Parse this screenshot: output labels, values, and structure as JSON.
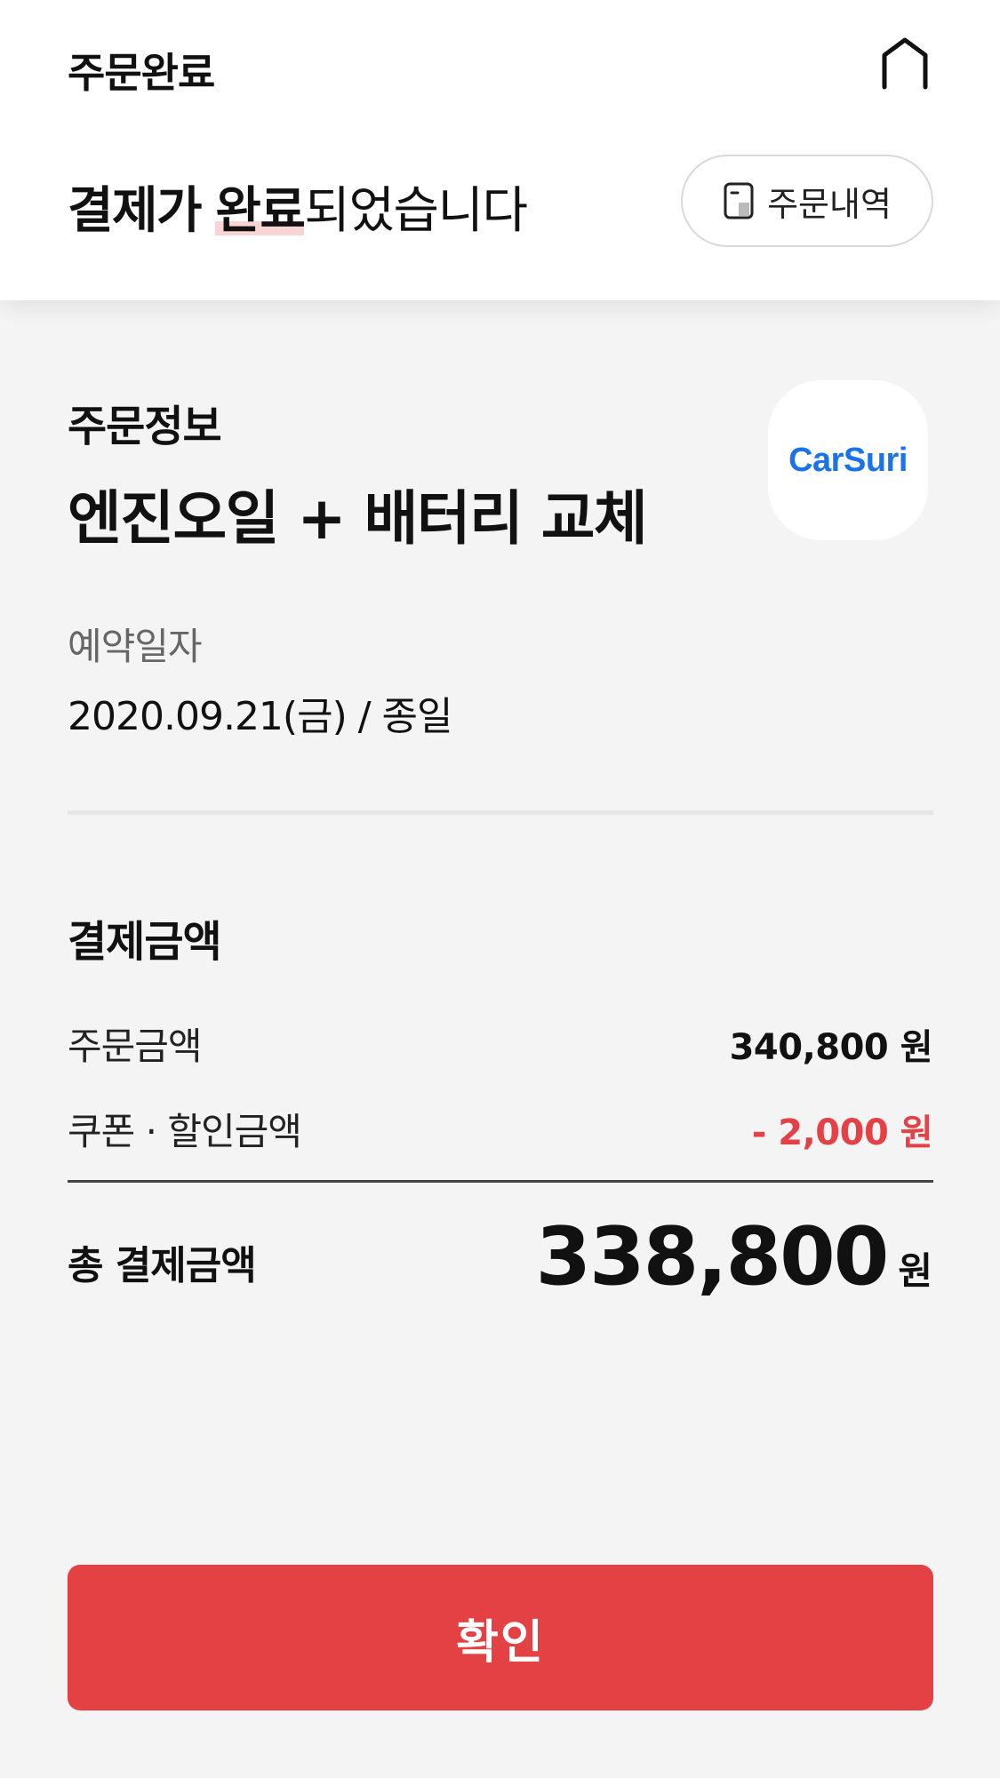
{
  "header": {
    "nav_title": "주문완료",
    "headline_strong": "결제가",
    "headline_highlight": "완료",
    "headline_rest": "되었습니다",
    "history_button_label": "주문내역"
  },
  "order_info": {
    "section_title": "주문정보",
    "product_name": "엔진오일 + 배터리 교체",
    "logo_text": "CarSuri",
    "reservation_label": "예약일자",
    "reservation_value": "2020.09.21(금) / 종일"
  },
  "payment": {
    "section_title": "결제금액",
    "order_amount_label": "주문금액",
    "order_amount_value": "340,800 원",
    "discount_label": "쿠폰 · 할인금액",
    "discount_value": "- 2,000 원",
    "total_label": "총 결제금액",
    "total_value": "338,800",
    "total_unit": "원"
  },
  "confirm_button_label": "확인",
  "colors": {
    "accent_red": "#e44145",
    "logo_blue": "#1a73e8",
    "background": "#f4f4f4"
  },
  "icons": {
    "home": "home-icon",
    "order_history": "receipt-icon"
  }
}
